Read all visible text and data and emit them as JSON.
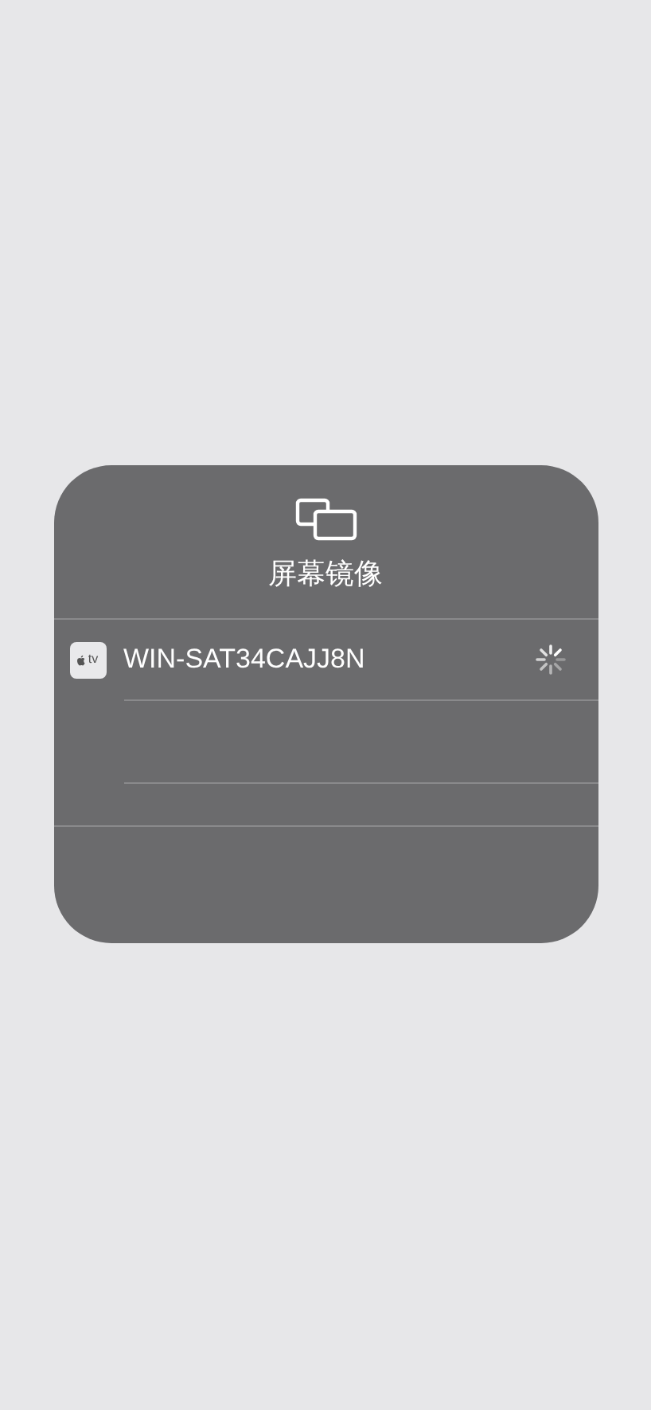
{
  "panel": {
    "title": "屏幕镜像"
  },
  "devices": [
    {
      "name": "WIN-SAT34CAJJ8N",
      "badge": "tv",
      "connecting": true
    }
  ]
}
